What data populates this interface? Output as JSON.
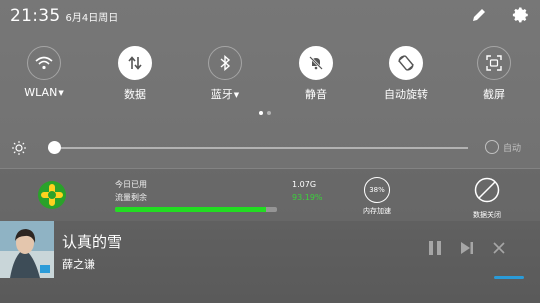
{
  "status": {
    "time": "21:35",
    "date": "6月4日周日"
  },
  "icons": {
    "edit": "pencil-icon",
    "settings": "gear-icon"
  },
  "toggles": [
    {
      "label": "WLAN",
      "icon": "wifi-icon",
      "state": "off",
      "has_dropdown": true
    },
    {
      "label": "数据",
      "icon": "mobile-data-icon",
      "state": "on",
      "has_dropdown": false
    },
    {
      "label": "蓝牙",
      "icon": "bluetooth-icon",
      "state": "off",
      "has_dropdown": true
    },
    {
      "label": "静音",
      "icon": "bell-off-icon",
      "state": "on",
      "has_dropdown": false
    },
    {
      "label": "自动旋转",
      "icon": "rotate-icon",
      "state": "on",
      "has_dropdown": false
    },
    {
      "label": "截屏",
      "icon": "screenshot-icon",
      "state": "off",
      "has_dropdown": false
    }
  ],
  "page_indicator": {
    "pages": 2,
    "current": 1
  },
  "brightness": {
    "level": 0.01,
    "auto_label": "自动"
  },
  "data_card": {
    "line1": "今日已用",
    "line2": "流量剩余",
    "used_value": "1.07G",
    "remaining_value": "93.19%",
    "usage_fraction": 0.93,
    "memory_percent": "38%",
    "memory_label": "内存加速",
    "off_label": "数据关闭",
    "accent": "#22dd22"
  },
  "media": {
    "title": "认真的雪",
    "artist": "薛之谦",
    "icons": [
      "pause-icon",
      "next-icon",
      "close-icon"
    ],
    "accent": "#2a9bd8"
  }
}
